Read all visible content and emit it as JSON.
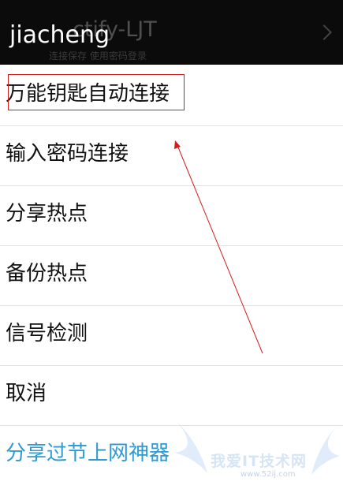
{
  "background_screen": {
    "title": "ctify-LJT",
    "subtitle": "连接保存 使用密码登录"
  },
  "dialog": {
    "title": "jiacheng",
    "items": [
      {
        "label": "万能钥匙自动连接"
      },
      {
        "label": "输入密码连接"
      },
      {
        "label": "分享热点"
      },
      {
        "label": "备份热点"
      },
      {
        "label": "信号检测"
      },
      {
        "label": "取消"
      },
      {
        "label": "分享过节上网神器"
      }
    ]
  },
  "annotation": {
    "highlight_color": "#d21c1c"
  },
  "watermark": {
    "text": "我爱IT技术网",
    "url": "www.52ij.com"
  },
  "colors": {
    "title_bar": "#0b0b0b",
    "accent": "#2e9ad3",
    "text": "#111111"
  }
}
